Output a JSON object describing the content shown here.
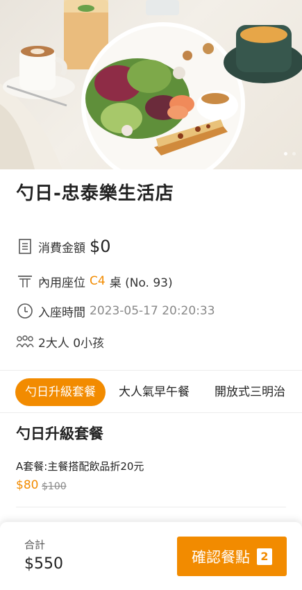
{
  "store": {
    "name": "勺日-忠泰樂生活店"
  },
  "info": {
    "amount_label": "消費金額",
    "amount_value": "$0",
    "seat_label": "內用座位",
    "seat_table": "C4",
    "seat_suffix": "桌 (No. 93)",
    "time_label": "入座時間",
    "time_value": "2023-05-17 20:20:33",
    "guests": "2大人 0小孩"
  },
  "tabs": [
    {
      "label": "勺日升級套餐",
      "active": true
    },
    {
      "label": "大人氣早午餐",
      "active": false
    },
    {
      "label": "開放式三明治",
      "active": false
    }
  ],
  "section": {
    "title": "勺日升級套餐",
    "items": [
      {
        "name": "A套餐:主餐搭配飲品折20元",
        "price": "$80",
        "original_price": "$100"
      }
    ]
  },
  "footer": {
    "total_label": "合計",
    "total_value": "$550",
    "confirm_label": "確認餐點",
    "cart_count": "2"
  },
  "colors": {
    "accent": "#f28b00"
  },
  "icons": [
    "receipt-icon",
    "table-icon",
    "clock-icon",
    "people-icon"
  ]
}
